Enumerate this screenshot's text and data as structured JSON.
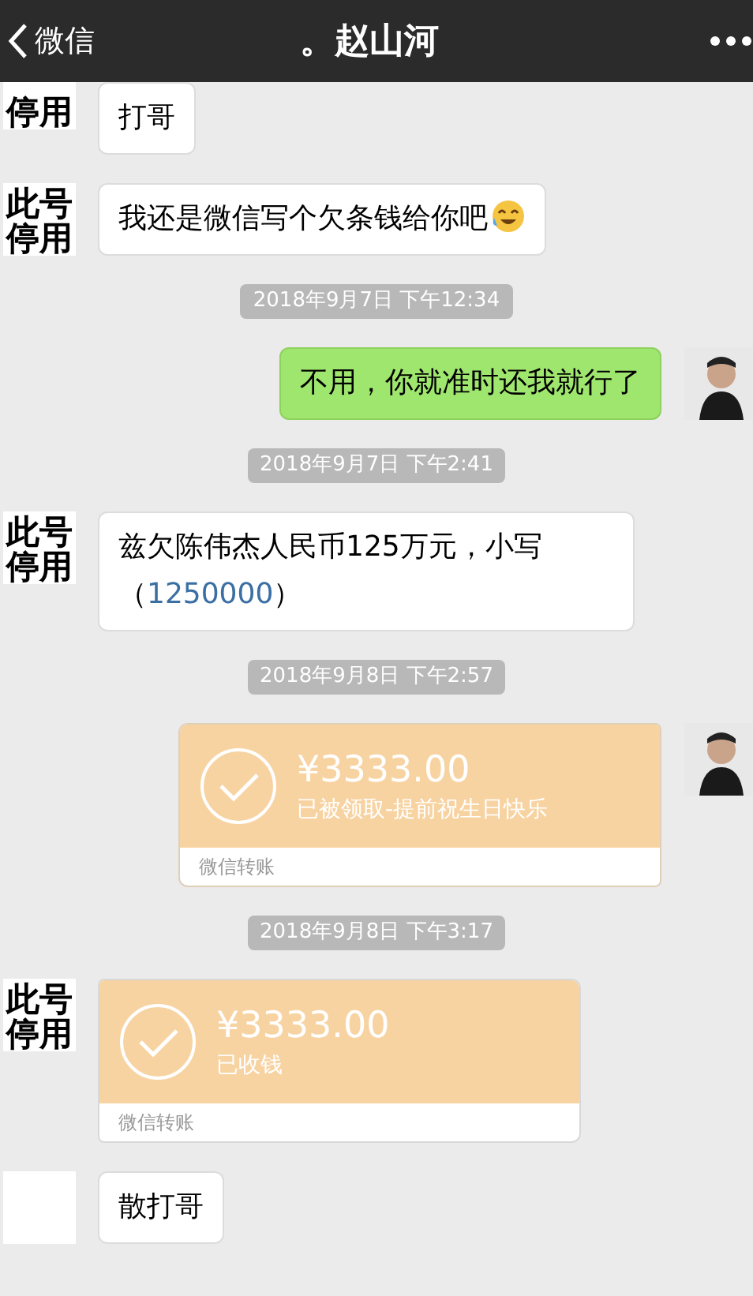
{
  "header": {
    "back_label": "微信",
    "title": "。赵山河"
  },
  "messages": [
    {
      "kind": "text",
      "outgoing": false,
      "avatar_text": [
        "停用"
      ],
      "text": "打哥"
    },
    {
      "kind": "text",
      "outgoing": false,
      "avatar_text": [
        "此号",
        "停用"
      ],
      "text": "我还是微信写个欠条钱给你吧",
      "emoji": true
    },
    {
      "kind": "time",
      "text": "2018年9月7日 下午12:34"
    },
    {
      "kind": "text",
      "outgoing": true,
      "text": "不用，你就准时还我就行了"
    },
    {
      "kind": "time",
      "text": "2018年9月7日 下午2:41"
    },
    {
      "kind": "text",
      "outgoing": false,
      "avatar_text": [
        "此号",
        "停用"
      ],
      "text": "兹欠陈伟杰人民币125万元，小写（",
      "number": "1250000",
      "text_end": "）"
    },
    {
      "kind": "time",
      "text": "2018年9月8日 下午2:57"
    },
    {
      "kind": "transfer",
      "outgoing": true,
      "amount": "¥3333.00",
      "note": "已被领取-提前祝生日快乐",
      "footer": "微信转账"
    },
    {
      "kind": "time",
      "text": "2018年9月8日 下午3:17"
    },
    {
      "kind": "transfer",
      "outgoing": false,
      "avatar_text": [
        "此号",
        "停用"
      ],
      "amount": "¥3333.00",
      "note": "已收钱",
      "footer": "微信转账"
    },
    {
      "kind": "text",
      "outgoing": false,
      "text": "散打哥"
    }
  ]
}
